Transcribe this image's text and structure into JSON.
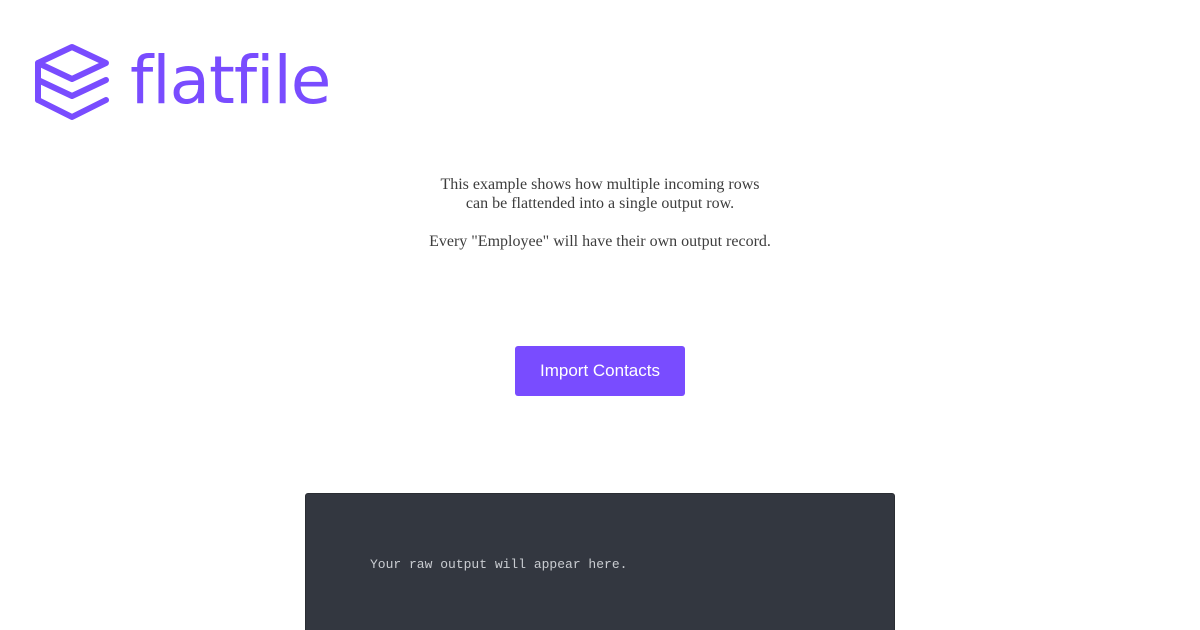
{
  "brand": {
    "name": "flatfile",
    "color": "#794cff",
    "logo_icon": "stacked-layers-icon"
  },
  "intro": {
    "line1": "This example shows how multiple incoming rows",
    "line2": "can be flattended into a single output row.",
    "line3": "Every \"Employee\" will have their own output record."
  },
  "import_button": {
    "label": "Import Contacts"
  },
  "output": {
    "placeholder": "Your raw output will appear here."
  }
}
